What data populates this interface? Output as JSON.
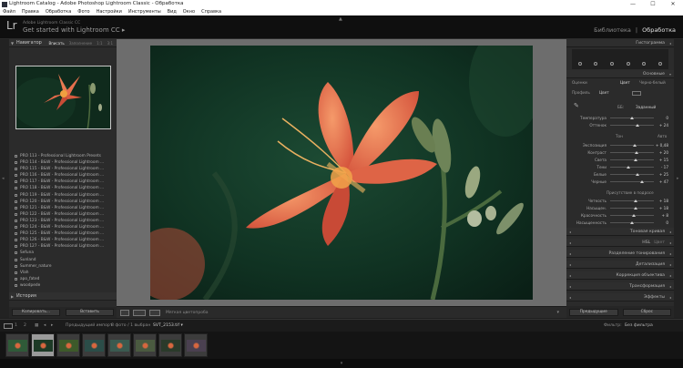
{
  "window": {
    "title": "Lightroom Catalog - Adobe Photoshop Lightroom Classic - Обработка",
    "minimize": "—",
    "maximize": "☐",
    "close": "✕"
  },
  "menu": [
    "Файл",
    "Правка",
    "Обработка",
    "Фото",
    "Настройки",
    "Инструменты",
    "Вид",
    "Окно",
    "Справка"
  ],
  "identity": {
    "logo": "Lr",
    "subtitle": "Adobe Lightroom Classic CC",
    "main": "Get started with Lightroom CC ▸",
    "modules": [
      "Библиотека",
      "|",
      "Обработка"
    ]
  },
  "left_panel": {
    "navigator_title": "Навигатор",
    "navigator_opts": [
      "Вписать",
      "Заполнение",
      "1:1",
      "3:1"
    ],
    "presets": [
      "PRO 113 - Professional Lightroom Presets",
      "PRO 114 - B&W - Professional Lightroom ...",
      "PRO 115 - B&W - Professional Lightroom ...",
      "PRO 116 - B&W - Professional Lightroom ...",
      "PRO 117 - B&W - Professional Lightroom ...",
      "PRO 118 - B&W - Professional Lightroom ...",
      "PRO 119 - B&W - Professional Lightroom ...",
      "PRO 120 - B&W - Professional Lightroom ...",
      "PRO 121 - B&W - Professional Lightroom ...",
      "PRO 122 - B&W - Professional Lightroom ...",
      "PRO 123 - B&W - Professional Lightroom ...",
      "PRO 124 - B&W - Professional Lightroom ...",
      "PRO 125 - B&W - Professional Lightroom ...",
      "PRO 126 - B&W - Professional Lightroom ...",
      "PRO 127 - B&W - Professional Lightroom ...",
      "Sefuna",
      "Sunland",
      "Summer_nature",
      "Vlah",
      "apo_fated",
      "woodpede"
    ],
    "history_title": "История",
    "copy_btn": "Копировать...",
    "paste_btn": "Вставить"
  },
  "toolbar": {
    "softproof": "Мягкая цветопроба"
  },
  "right_panel": {
    "histogram": "Гистограмма",
    "basic": "Основные",
    "treatment_label": "Оценки",
    "treatment_color": "Цвет",
    "treatment_bw": "Черно-белый",
    "profile_label": "Профиль",
    "profile_value": "Цвет",
    "wb_label": "ББ:",
    "wb_value": "Заданный",
    "rows_wb": [
      {
        "label": "Температура",
        "value": "0",
        "pos": 0.5
      },
      {
        "label": "Оттенок",
        "value": "+ 24",
        "pos": 0.62
      }
    ],
    "tone_label": "Тон",
    "tone_auto": "Авто",
    "rows_tone": [
      {
        "label": "Экспозиция",
        "value": "+ 0,48",
        "pos": 0.56
      },
      {
        "label": "Контраст",
        "value": "+ 20",
        "pos": 0.6
      },
      {
        "label": "Света",
        "value": "+ 15",
        "pos": 0.58
      },
      {
        "label": "Тени",
        "value": "- 17",
        "pos": 0.42
      },
      {
        "label": "Белые",
        "value": "+ 25",
        "pos": 0.62
      },
      {
        "label": "Черные",
        "value": "+ 47",
        "pos": 0.72
      }
    ],
    "presence_label": "Присутствие в подросе",
    "rows_presence": [
      {
        "label": "Четкость",
        "value": "+ 18",
        "pos": 0.59
      },
      {
        "label": "Насыщен.",
        "value": "+ 18",
        "pos": 0.59
      },
      {
        "label": "Красочность",
        "value": "+ 8",
        "pos": 0.54
      },
      {
        "label": "Насыщенность",
        "value": "0",
        "pos": 0.5
      }
    ],
    "sections": [
      "Тоновая кривая",
      "HSL",
      "Разделение тонирования",
      "Детализация",
      "Коррекция объектива",
      "Трансформация",
      "Эффекты"
    ],
    "hsl_extra": "Цвет",
    "prev_btn": "Предыдущие",
    "reset_btn": "Сброс"
  },
  "filmstrip_bar": {
    "page1": "1",
    "page2": "2",
    "source": "Предыдущий импорт",
    "count": "8 фото / 1 выбран",
    "filename": "SVT_2153.tif ▾",
    "filter_label": "Фильтр:",
    "filter_value": "Без фильтра"
  },
  "thumbs": 8,
  "bottom": "▾"
}
